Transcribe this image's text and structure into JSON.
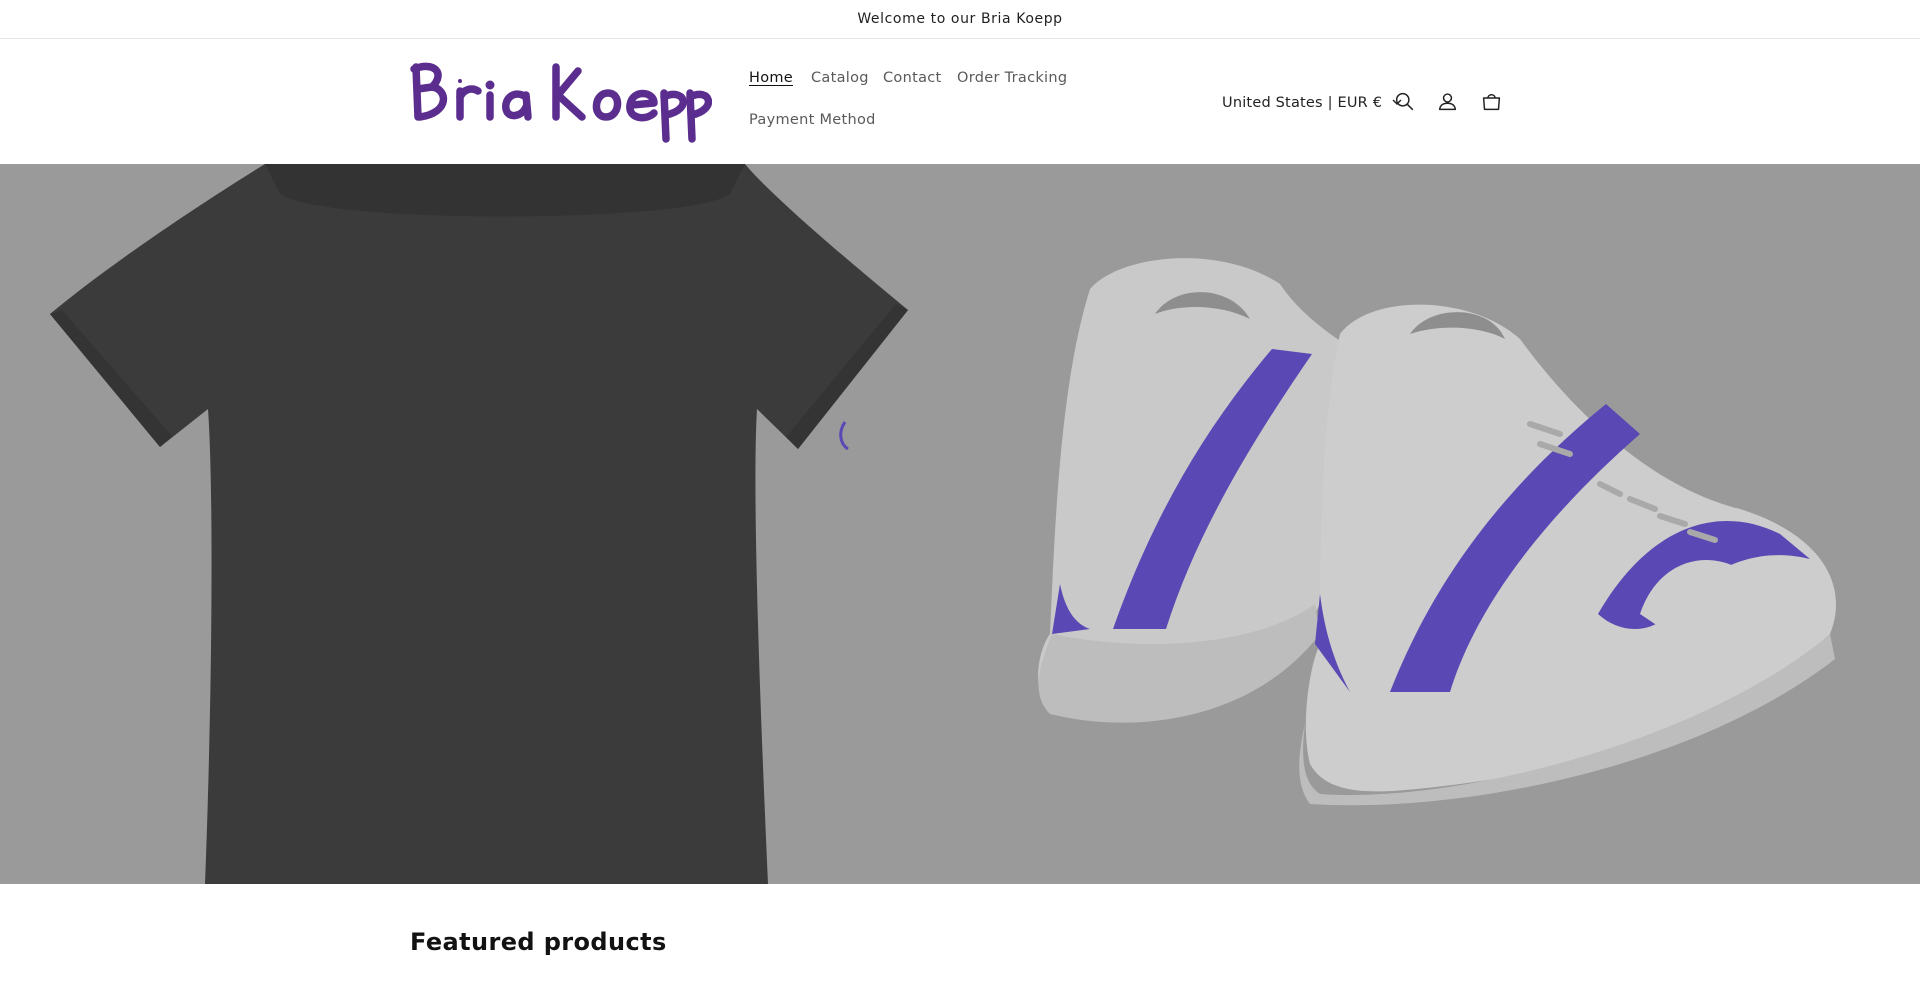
{
  "announcement": {
    "text": "Welcome to our Bria Koepp"
  },
  "brand": {
    "name": "Bria Koepp",
    "logo_color": "#5b2d8e"
  },
  "nav": {
    "items": [
      {
        "label": "Home",
        "active": true
      },
      {
        "label": "Catalog"
      },
      {
        "label": "Contact"
      },
      {
        "label": "Order Tracking"
      },
      {
        "label": "Payment Method"
      }
    ]
  },
  "header": {
    "country_selector": "United States | EUR €",
    "icons": [
      "search-icon",
      "account-icon",
      "cart-icon"
    ]
  },
  "hero": {
    "images": [
      "dark t-shirt",
      "high-top sneakers with purple stripe"
    ],
    "accent_color": "#5a48b4"
  },
  "featured": {
    "heading": "Featured products"
  }
}
